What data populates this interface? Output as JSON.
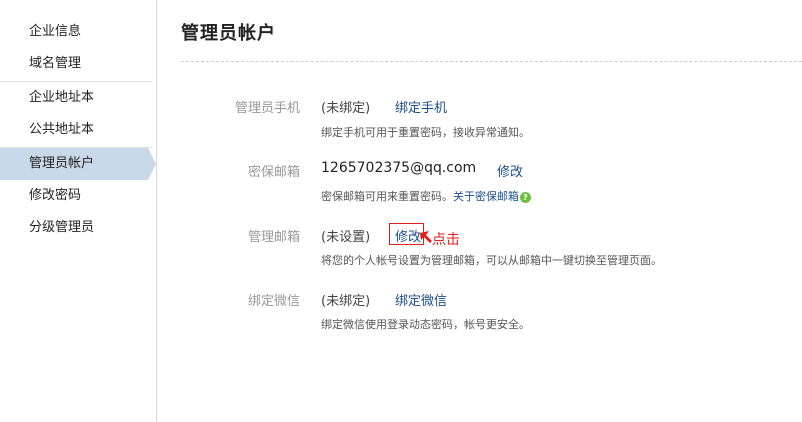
{
  "sidebar": {
    "items": [
      {
        "label": "企业信息"
      },
      {
        "label": "域名管理"
      },
      {
        "label": "企业地址本"
      },
      {
        "label": "公共地址本"
      },
      {
        "label": "管理员帐户"
      },
      {
        "label": "修改密码"
      },
      {
        "label": "分级管理员"
      }
    ],
    "active_index": 4
  },
  "main": {
    "title": "管理员帐户",
    "rows": [
      {
        "label": "管理员手机",
        "value": "(未绑定)",
        "link": "绑定手机",
        "desc": "绑定手机可用于重置密码，接收异常通知。"
      },
      {
        "label": "密保邮箱",
        "value": "1265702375@qq.com",
        "link": "修改",
        "desc": "密保邮箱可用来重置密码。",
        "desc_link": "关于密保邮箱",
        "help_icon": "question-icon"
      },
      {
        "label": "管理邮箱",
        "value": "(未设置)",
        "link": "修改",
        "desc": "将您的个人帐号设置为管理邮箱，可以从邮箱中一键切换至管理页面。"
      },
      {
        "label": "绑定微信",
        "value": "(未绑定)",
        "link": "绑定微信",
        "desc": "绑定微信使用登录动态密码，帐号更安全。"
      }
    ]
  },
  "annotation": {
    "text": "点击",
    "color": "#e0201a"
  },
  "colors": {
    "accent_link": "#1b4f8c",
    "active_bg": "#c9d9ea",
    "label_gray": "#999999"
  }
}
